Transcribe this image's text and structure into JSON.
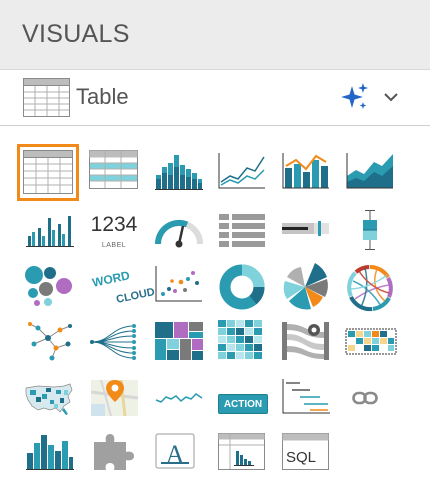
{
  "header": {
    "title": "VISUALS"
  },
  "selector": {
    "current_visual": "Table",
    "icon": "table-icon",
    "ai_icon": "sparkle-icon",
    "dropdown_icon": "chevron-down-icon"
  },
  "visuals": [
    {
      "name": "Table",
      "icon": "table-icon",
      "selected": true
    },
    {
      "name": "Cross Tabulation",
      "icon": "cross-tab-icon"
    },
    {
      "name": "Stacked Bars",
      "icon": "stacked-bars-icon"
    },
    {
      "name": "Lines",
      "icon": "lines-icon"
    },
    {
      "name": "Combo",
      "icon": "combo-icon"
    },
    {
      "name": "Areas",
      "icon": "areas-icon"
    },
    {
      "name": "Bars",
      "icon": "bars-icon"
    },
    {
      "name": "KPI",
      "icon": "kpi-icon",
      "text": "1234",
      "subtext": "LABEL"
    },
    {
      "name": "Gauge",
      "icon": "gauge-icon"
    },
    {
      "name": "Bullet List",
      "icon": "list-icon"
    },
    {
      "name": "Bullet",
      "icon": "bullet-icon"
    },
    {
      "name": "Box Plot",
      "icon": "box-plot-icon"
    },
    {
      "name": "Packed Bubbles",
      "icon": "packed-bubbles-icon"
    },
    {
      "name": "Word Cloud",
      "icon": "word-cloud-icon",
      "words": [
        "WORD",
        "CLOUD"
      ]
    },
    {
      "name": "Scatter",
      "icon": "scatter-icon"
    },
    {
      "name": "Donut",
      "icon": "donut-icon"
    },
    {
      "name": "Radial",
      "icon": "radial-icon"
    },
    {
      "name": "Chord",
      "icon": "chord-icon"
    },
    {
      "name": "Network",
      "icon": "network-icon"
    },
    {
      "name": "Dendrogram",
      "icon": "dendrogram-icon"
    },
    {
      "name": "Tree Map",
      "icon": "treemap-icon"
    },
    {
      "name": "Heat Map",
      "icon": "heatmap-icon"
    },
    {
      "name": "Flow",
      "icon": "flow-icon"
    },
    {
      "name": "Correlation Heatmap",
      "icon": "correlation-icon"
    },
    {
      "name": "Map",
      "icon": "us-map-icon"
    },
    {
      "name": "Interactive Map",
      "icon": "interactive-map-icon"
    },
    {
      "name": "Sparklines",
      "icon": "sparkline-icon"
    },
    {
      "name": "Action",
      "icon": "action-icon",
      "text": "ACTION"
    },
    {
      "name": "Gantt",
      "icon": "gantt-icon"
    },
    {
      "name": "Link",
      "icon": "link-icon"
    },
    {
      "name": "Histogram",
      "icon": "histogram-icon"
    },
    {
      "name": "Extensions",
      "icon": "puzzle-icon"
    },
    {
      "name": "Rich Text",
      "icon": "rich-text-icon",
      "text": "A"
    },
    {
      "name": "Pivot",
      "icon": "pivot-icon"
    },
    {
      "name": "SQL",
      "icon": "sql-icon",
      "text": "SQL"
    }
  ],
  "colors": {
    "teal": "#2a9bb0",
    "dark_teal": "#1f6f8a",
    "orange": "#f28a1a",
    "selected_border": "#f28a1a",
    "sparkle_blue": "#2366c8"
  }
}
